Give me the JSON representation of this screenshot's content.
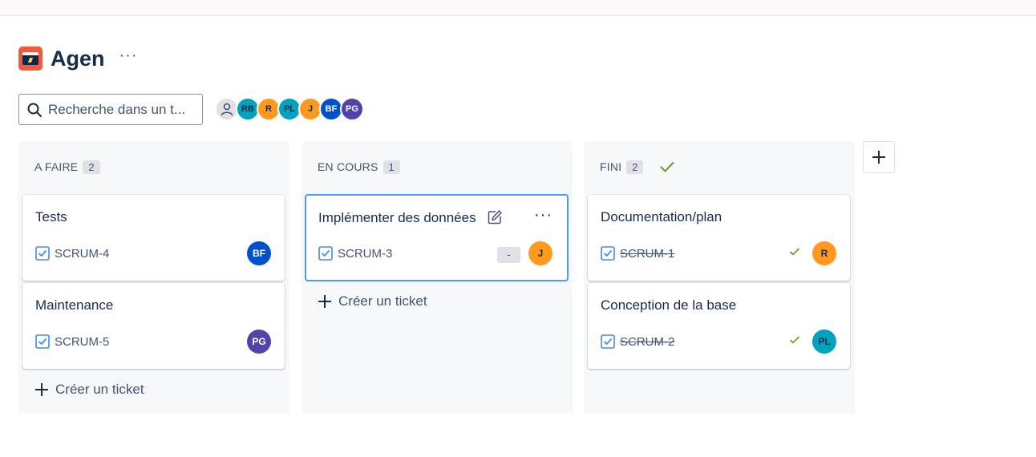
{
  "project": {
    "title": "Agen",
    "more_label": "···"
  },
  "search": {
    "placeholder": "Recherche dans un t..."
  },
  "avatars": [
    {
      "initials": "",
      "bg": "#dfe1e6",
      "fg": "#44546f",
      "icon": "person-icon"
    },
    {
      "initials": "RB",
      "bg": "#00a3bf",
      "fg": "#172b4d"
    },
    {
      "initials": "R",
      "bg": "#ff991f",
      "fg": "#172b4d"
    },
    {
      "initials": "PL",
      "bg": "#00a3bf",
      "fg": "#172b4d"
    },
    {
      "initials": "J",
      "bg": "#ff991f",
      "fg": "#172b4d"
    },
    {
      "initials": "BF",
      "bg": "#0052cc",
      "fg": "#ffffff"
    },
    {
      "initials": "PG",
      "bg": "#5243aa",
      "fg": "#ffffff"
    }
  ],
  "columns": [
    {
      "title": "A FAIRE",
      "count": "2",
      "create_label": "Créer un ticket",
      "cards": [
        {
          "title": "Tests",
          "key": "SCRUM-4",
          "assignee": "BF"
        },
        {
          "title": "Maintenance",
          "key": "SCRUM-5",
          "assignee": "PG"
        }
      ]
    },
    {
      "title": "EN COURS",
      "count": "1",
      "create_label": "Créer un ticket",
      "cards": [
        {
          "title": "Implémenter des données",
          "key": "SCRUM-3",
          "estimate": "-",
          "assignee": "J"
        }
      ]
    },
    {
      "title": "FINI",
      "count": "2",
      "cards": [
        {
          "title": "Documentation/plan",
          "key": "SCRUM-1",
          "assignee": "R"
        },
        {
          "title": "Conception de la base",
          "key": "SCRUM-2",
          "assignee": "PL"
        }
      ]
    }
  ],
  "colors": {
    "accent_blue": "#4c9aff",
    "check_green": "#6a9a23",
    "task_icon_blue": "#4688ec"
  }
}
